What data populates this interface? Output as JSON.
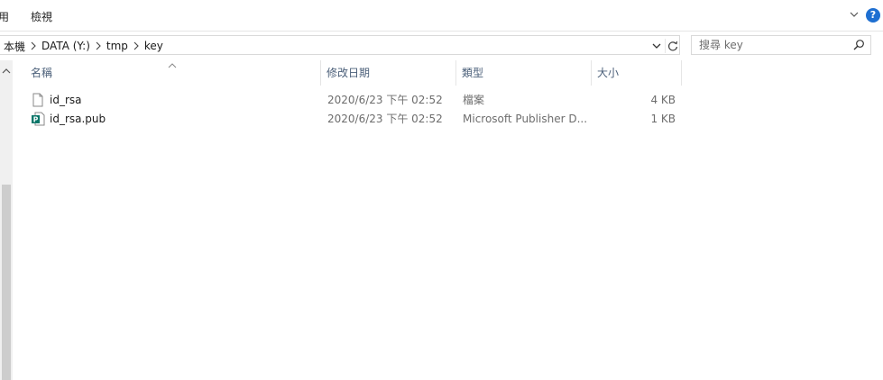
{
  "ribbon": {
    "partial_tab": "用",
    "view_tab": "檢視",
    "help_label": "?"
  },
  "address": {
    "crumbs": [
      "本機",
      "DATA (Y:)",
      "tmp",
      "key"
    ]
  },
  "search": {
    "placeholder": "搜尋 key"
  },
  "columns": {
    "name": "名稱",
    "modified": "修改日期",
    "type": "類型",
    "size": "大小"
  },
  "files": [
    {
      "name": "id_rsa",
      "modified": "2020/6/23 下午 02:52",
      "type": "檔案",
      "size": "4 KB",
      "icon": "blank-file-icon"
    },
    {
      "name": "id_rsa.pub",
      "modified": "2020/6/23 下午 02:52",
      "type": "Microsoft Publisher D...",
      "size": "1 KB",
      "icon": "publisher-file-icon"
    }
  ],
  "colors": {
    "accent": "#1e6fd1",
    "header_text": "#4c607a",
    "publisher_green": "#077568"
  }
}
